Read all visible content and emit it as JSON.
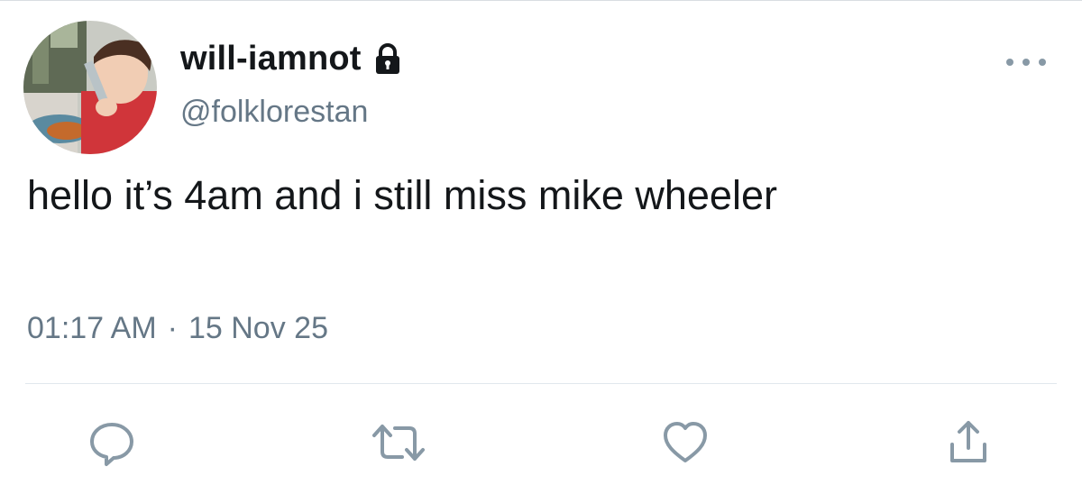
{
  "tweet": {
    "display_name": "will-iamnot",
    "handle": "@folklorestan",
    "text": "hello it’s 4am and i still miss mike wheeler",
    "time": "01:17 AM",
    "separator": "·",
    "date": "15 Nov 25",
    "protected_icon": "lock-icon",
    "avatar_icon": "avatar"
  },
  "actions": [
    {
      "name": "reply-button",
      "icon": "reply-icon"
    },
    {
      "name": "retweet-button",
      "icon": "retweet-icon"
    },
    {
      "name": "like-button",
      "icon": "heart-icon"
    },
    {
      "name": "share-button",
      "icon": "share-icon"
    }
  ],
  "colors": {
    "text_primary": "#14171a",
    "text_secondary": "#657786",
    "icon_gray": "#8899a6",
    "divider": "#e1e8ed"
  }
}
